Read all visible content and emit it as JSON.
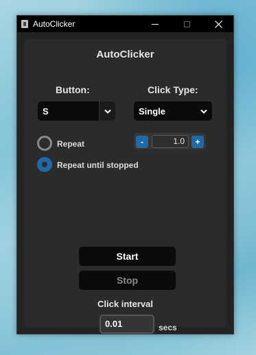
{
  "window": {
    "title": "AutoClicker"
  },
  "main": {
    "heading": "AutoClicker",
    "button_label": "Button:",
    "button_value": "S",
    "click_type_label": "Click Type:",
    "click_type_value": "Single",
    "repeat_label": "Repeat",
    "repeat_until_stopped_label": "Repeat until stopped",
    "selected_repeat_mode": "Repeat until stopped",
    "repeat_count": "1.0",
    "decrement_label": "-",
    "increment_label": "+",
    "start_label": "Start",
    "stop_label": "Stop",
    "interval_label": "Click interval",
    "interval_value": "0.01",
    "interval_unit": "secs"
  },
  "icons": {
    "app": "app-icon",
    "minimize": "minimize-icon",
    "maximize": "maximize-icon",
    "close": "close-icon",
    "dropdown": "chevron-down-icon"
  },
  "colors": {
    "accent": "#1f6aa5",
    "panel": "#2b2b2b",
    "window": "#232323",
    "titlebar": "#000000"
  }
}
